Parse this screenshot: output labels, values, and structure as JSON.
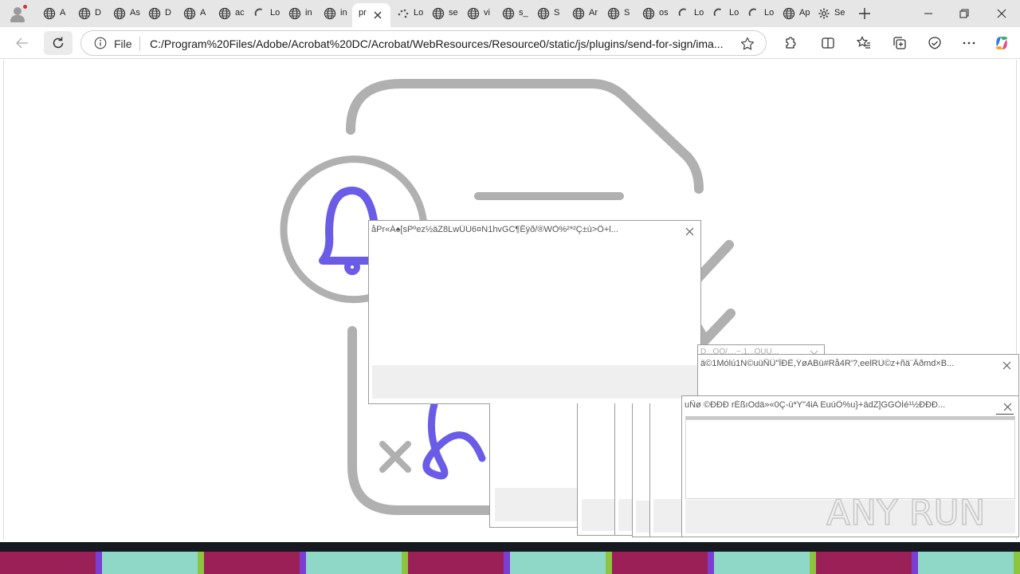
{
  "browser": {
    "tabs": [
      {
        "label": "A",
        "icon": "globe-icon"
      },
      {
        "label": "D",
        "icon": "globe-icon"
      },
      {
        "label": "As",
        "icon": "globe-icon"
      },
      {
        "label": "D",
        "icon": "globe-icon"
      },
      {
        "label": "A",
        "icon": "globe-icon"
      },
      {
        "label": "ac",
        "icon": "globe-icon"
      },
      {
        "label": "Lo",
        "icon": "loading-spinner-icon"
      },
      {
        "label": "in",
        "icon": "globe-icon"
      },
      {
        "label": "in",
        "icon": "globe-icon"
      },
      {
        "label": "pr",
        "icon": "none",
        "active": true
      },
      {
        "label": "Lo",
        "icon": "loading-dots-icon"
      },
      {
        "label": "se",
        "icon": "globe-icon"
      },
      {
        "label": "vi",
        "icon": "globe-icon"
      },
      {
        "label": "s_",
        "icon": "globe-icon"
      },
      {
        "label": "S",
        "icon": "globe-icon"
      },
      {
        "label": "Ar",
        "icon": "globe-icon"
      },
      {
        "label": "S",
        "icon": "globe-icon"
      },
      {
        "label": "os",
        "icon": "globe-icon"
      },
      {
        "label": "Lo",
        "icon": "loading-spinner-icon"
      },
      {
        "label": "Lo",
        "icon": "loading-spinner-icon"
      },
      {
        "label": "Lo",
        "icon": "loading-spinner-icon"
      },
      {
        "label": "Ap",
        "icon": "globe-icon"
      },
      {
        "label": "Se",
        "icon": "gear-icon"
      }
    ],
    "address": {
      "scheme_label": "File",
      "url": "C:/Program%20Files/Adobe/Acrobat%20DC/Acrobat/WebResources/Resource0/static/js/plugins/send-for-sign/ima..."
    },
    "accent_color": "#6b5ce7"
  },
  "dialogs": [
    {
      "title": "åPr«Á♠[sPºez½äZ8LwÛÙ6¤N1hvGC¶Êÿð/®WÒ%²*²Ç±ù>Ö+l..."
    },
    {
      "title": "ä©1Mólú1N©uüÑÜ\"ÎÐÈ,ÝøABü#Rå4R'?,eelRÙ©z+ñä¨Âðmd×B..."
    },
    {
      "title": "uÑø ©ÐÐÐ rÉßıOdä»«0Ç-ù*Y\"4iA EuúÔ%u}+ädZ]GGÒÍé¹½ÐÐÐ..."
    },
    {
      "title": "D...ÔÓ/...,~,1...ÖUU..."
    }
  ],
  "watermark": {
    "text": "ANY RUN"
  }
}
